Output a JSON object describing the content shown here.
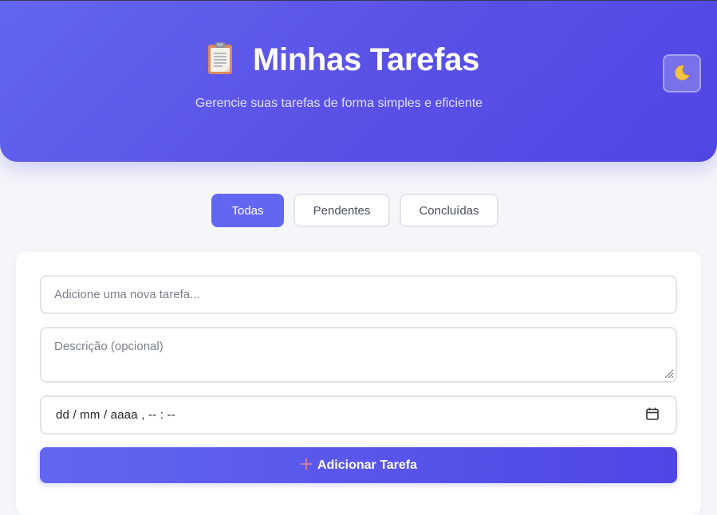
{
  "header": {
    "title": "Minhas Tarefas",
    "subtitle": "Gerencie suas tarefas de forma simples e eficiente",
    "title_icon": "clipboard-icon",
    "theme_toggle_icon": "moon-icon"
  },
  "filters": [
    {
      "label": "Todas",
      "active": true
    },
    {
      "label": "Pendentes",
      "active": false
    },
    {
      "label": "Concluídas",
      "active": false
    }
  ],
  "form": {
    "task_placeholder": "Adicione uma nova tarefa...",
    "task_value": "",
    "description_placeholder": "Descrição (opcional)",
    "description_value": "",
    "date_placeholder": "dd / mm / aaaa ,  -- : --",
    "date_icon": "calendar-icon",
    "add_button_icon": "plus-icon",
    "add_button_label": "Adicionar Tarefa"
  },
  "colors": {
    "primary": "#6366f1",
    "primary_dark": "#4f46e5",
    "background": "#f5f6fa",
    "card": "#ffffff"
  }
}
